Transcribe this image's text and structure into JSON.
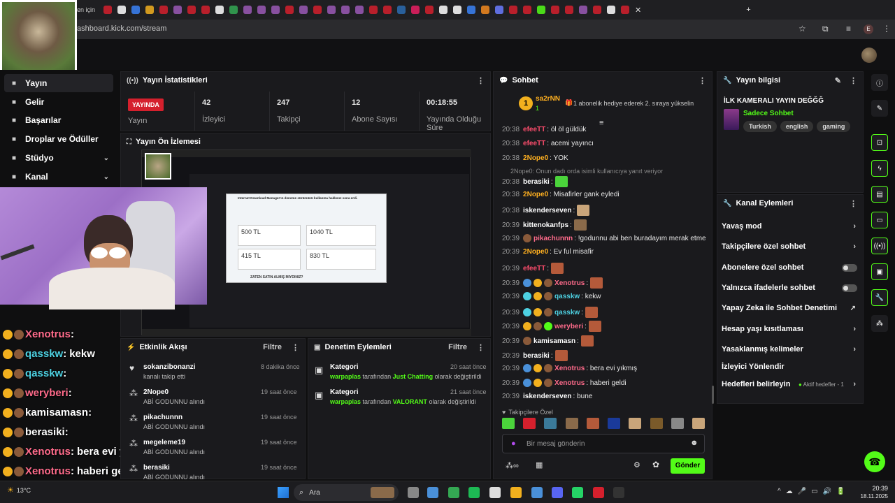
{
  "browser": {
    "tab_label": "en için",
    "url": "ashboard.kick.com/stream",
    "profile_letter": "E"
  },
  "sidebar": {
    "items": [
      {
        "label": "Yayın",
        "icon": "broadcast-icon"
      },
      {
        "label": "Gelir",
        "icon": "revenue-icon"
      },
      {
        "label": "Başarılar",
        "icon": "trophy-icon"
      },
      {
        "label": "Droplar ve Ödüller",
        "icon": "gift-icon"
      },
      {
        "label": "Stüdyo",
        "icon": "studio-icon"
      },
      {
        "label": "Kanal",
        "icon": "channel-icon"
      }
    ]
  },
  "stats": {
    "title": "Yayın İstatistikleri",
    "live_badge": "YAYINDA",
    "items": [
      {
        "value": "",
        "label": "Yayın"
      },
      {
        "value": "42",
        "label": "İzleyici"
      },
      {
        "value": "247",
        "label": "Takipçi"
      },
      {
        "value": "12",
        "label": "Abone Sayısı"
      },
      {
        "value": "00:18:55",
        "label": "Yayında Olduğu Süre"
      }
    ]
  },
  "preview": {
    "title": "Yayın Ön İzlemesi",
    "popup_title": "Internet Download Manager'ın deneme sürümünü kullanma hakkınız sona erdi.",
    "prices": [
      "500 TL",
      "1040 TL",
      "415 TL",
      "830 TL"
    ],
    "popup_footer": "ZATEN SATIN ALMIŞ MIYDINIZ?"
  },
  "activity": {
    "title": "Etkinlik Akışı",
    "filter": "Filtre",
    "items": [
      {
        "name": "sokanzibonanzi",
        "sub": "kanalı takip etti",
        "time": "8 dakika önce",
        "icon": "heart-icon"
      },
      {
        "name": "2Nope0",
        "sub": "ABİ GODUNNU alındı",
        "time": "19 saat önce",
        "icon": "reward-icon"
      },
      {
        "name": "pikachunnn",
        "sub": "ABİ GODUNNU alındı",
        "time": "19 saat önce",
        "icon": "reward-icon"
      },
      {
        "name": "megeleme19",
        "sub": "ABİ GODUNNU alındı",
        "time": "19 saat önce",
        "icon": "reward-icon"
      },
      {
        "name": "berasiki",
        "sub": "ABİ GODUNNU alındı",
        "time": "19 saat önce",
        "icon": "reward-icon"
      }
    ]
  },
  "moderation": {
    "title": "Denetim Eylemleri",
    "filter": "Filtre",
    "items": [
      {
        "name": "Kategori",
        "actor": "warpaplas",
        "mid": "tarafından",
        "value": "Just Chatting",
        "tail": "olarak değiştirildi",
        "time": "20 saat önce"
      },
      {
        "name": "Kategori",
        "actor": "warpaplas",
        "mid": "tarafından",
        "value": "VALORANT",
        "tail": "olarak değiştirildi",
        "time": "21 saat önce"
      }
    ]
  },
  "chat": {
    "title": "Sohbet",
    "pinned_user": "sa2rNN",
    "pinned_count": "1",
    "pinned_text": "1 abonelik hediye ederek 2. sıraya yükselin",
    "reply_note": "2Nope0: Onun dadı orda isimli kullanıcıya yanıt veriyor",
    "messages": [
      {
        "time": "20:38",
        "user": "efeeTT",
        "color": "#ff4d6d",
        "text": ": öl öl güldük"
      },
      {
        "time": "20:38",
        "user": "efeeTT",
        "color": "#ff4d6d",
        "text": ": acemi yayıncı"
      },
      {
        "time": "20:38",
        "user": "2Nope0",
        "color": "#ffb020",
        "text": ": YOK"
      },
      {
        "time": "20:38",
        "user": "berasiki",
        "color": "#ffffff",
        "text": ":"
      },
      {
        "time": "20:38",
        "user": "2Nope0",
        "color": "#ffb020",
        "text": ": Misafirler gank eyledi"
      },
      {
        "time": "20:38",
        "user": "iskenderseven",
        "color": "#ffffff",
        "text": ":"
      },
      {
        "time": "20:39",
        "user": "kittenokanfps",
        "color": "#ffffff",
        "text": ":"
      },
      {
        "time": "20:39",
        "user": "pikachunnn",
        "color": "#ff6b8b",
        "text": ": !godunnu abi ben buradayım merak etme"
      },
      {
        "time": "20:39",
        "user": "2Nope0",
        "color": "#ffb020",
        "text": ": Ev ful misafir"
      },
      {
        "time": "20:39",
        "user": "efeeTT",
        "color": "#ff4d6d",
        "text": ":"
      },
      {
        "time": "20:39",
        "user": "Xenotrus",
        "color": "#ff6b8b",
        "text": ":"
      },
      {
        "time": "20:39",
        "user": "qasskw",
        "color": "#4dd0e1",
        "text": ": kekw"
      },
      {
        "time": "20:39",
        "user": "qasskw",
        "color": "#4dd0e1",
        "text": ":"
      },
      {
        "time": "20:39",
        "user": "weryberi",
        "color": "#ff6b8b",
        "text": ":"
      },
      {
        "time": "20:39",
        "user": "kamisamasn",
        "color": "#ffffff",
        "text": ":"
      },
      {
        "time": "20:39",
        "user": "berasiki",
        "color": "#ffffff",
        "text": ":"
      },
      {
        "time": "20:39",
        "user": "Xenotrus",
        "color": "#ff6b8b",
        "text": ": bera evi yıkmış"
      },
      {
        "time": "20:39",
        "user": "Xenotrus",
        "color": "#ff6b8b",
        "text": ": haberi geldi"
      },
      {
        "time": "20:39",
        "user": "iskenderseven",
        "color": "#ffffff",
        "text": ": bune"
      }
    ],
    "follower_only": "Takipçilere Özel",
    "input_placeholder": "Bir mesaj gönderin",
    "send_label": "Gönder"
  },
  "stream_info": {
    "title": "Yayın bilgisi",
    "stream_title": "İLK KAMERALI YAYIN DEĞĞĞ",
    "category": "Sadece Sohbet",
    "tags": [
      "Turkish",
      "english",
      "gaming"
    ]
  },
  "channel_actions": {
    "title": "Kanal Eylemleri",
    "items": [
      {
        "label": "Yavaş mod",
        "type": "chevron"
      },
      {
        "label": "Takipçilere özel sohbet",
        "type": "chevron"
      },
      {
        "label": "Abonelere özel sohbet",
        "type": "toggle"
      },
      {
        "label": "Yalnızca ifadelerle sohbet",
        "type": "toggle"
      },
      {
        "label": "Yapay Zeka ile Sohbet Denetimi",
        "type": "external"
      },
      {
        "label": "Hesap yaşı kısıtlaması",
        "type": "chevron"
      },
      {
        "label": "Yasaklanmış kelimeler",
        "type": "chevron"
      },
      {
        "label": "İzleyici Yönlendir",
        "type": "none"
      },
      {
        "label": "Hedefleri belirleyin",
        "type": "chevron"
      }
    ],
    "goals_status": "Aktif hedefler - 1"
  },
  "overlay_chat": [
    {
      "user": "Xenotrus",
      "color": "#ff6b8b",
      "text": ""
    },
    {
      "user": "qasskw",
      "color": "#4dd0e1",
      "text": "kekw"
    },
    {
      "user": "qasskw",
      "color": "#4dd0e1",
      "text": ""
    },
    {
      "user": "weryberi",
      "color": "#ff6b8b",
      "text": ""
    },
    {
      "user": "kamisamasn",
      "color": "#ffffff",
      "text": ""
    },
    {
      "user": "berasiki",
      "color": "#ffffff",
      "text": ""
    },
    {
      "user": "Xenotrus",
      "color": "#ff6b8b",
      "text": "bera evi yıkmış"
    },
    {
      "user": "Xenotrus",
      "color": "#ff6b8b",
      "text": "haberi geldi"
    },
    {
      "user": "iskenderseven",
      "color": "#ffffff",
      "text": "bune"
    }
  ],
  "taskbar": {
    "weather": "13°C",
    "search_placeholder": "Ara",
    "time": "20:39",
    "date": "18.11.2025"
  }
}
